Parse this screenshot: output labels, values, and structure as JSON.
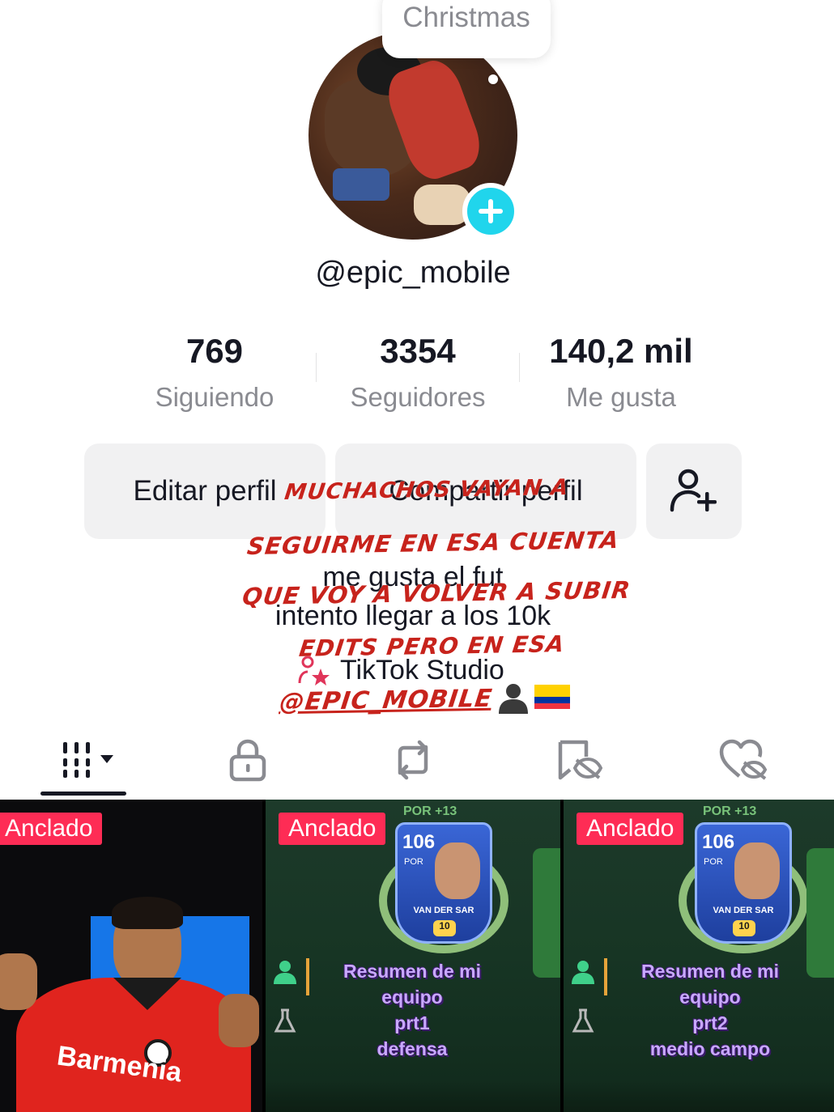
{
  "bubble_text": "Christmas",
  "username": "@epic_mobile",
  "stats": [
    {
      "value": "769",
      "label": "Siguiendo"
    },
    {
      "value": "3354",
      "label": "Seguidores"
    },
    {
      "value": "140,2 mil",
      "label": "Me gusta"
    }
  ],
  "buttons": {
    "edit": "Editar perfil",
    "share": "Compartir perfil",
    "add_friend_icon": "add-user-icon"
  },
  "bio": {
    "line1": "me gusta el fut",
    "line2": "intento llegar a los 10k",
    "studio": "TikTok Studio"
  },
  "overlay_caption": {
    "line1": "MUCHACHOS VAYAN A",
    "line2": "SEGUIRME EN ESA CUENTA",
    "line3": "QUE VOY A VOLVER A SUBIR",
    "line4": "EDITS PERO EN ESA",
    "line5": "@EPIC_MOBILE"
  },
  "tabs": [
    {
      "icon": "grid-icon",
      "active": true
    },
    {
      "icon": "lock-icon",
      "active": false
    },
    {
      "icon": "repost-icon",
      "active": false
    },
    {
      "icon": "favorites-icon",
      "active": false
    },
    {
      "icon": "liked-icon",
      "active": false
    }
  ],
  "videos": [
    {
      "badge": "Anclado",
      "overlay": "Barmenia"
    },
    {
      "badge": "Anclado",
      "topbar": "POR +13",
      "card_ovr": "106",
      "card_pos": "POR",
      "card_name": "VAN DER SAR",
      "card_rank": "10",
      "summary_line1": "Resumen de mi equipo",
      "summary_line2": "prt1",
      "summary_line3": "defensa"
    },
    {
      "badge": "Anclado",
      "topbar": "POR +13",
      "card_ovr": "106",
      "card_pos": "POR",
      "card_name": "VAN DER SAR",
      "card_rank": "10",
      "summary_line1": "Resumen de mi equipo",
      "summary_line2": "prt2",
      "summary_line3": "medio campo"
    }
  ],
  "colors": {
    "accent_cyan": "#20d5ec",
    "pin_red": "#fe2c55",
    "caption_red": "#c7231c"
  }
}
